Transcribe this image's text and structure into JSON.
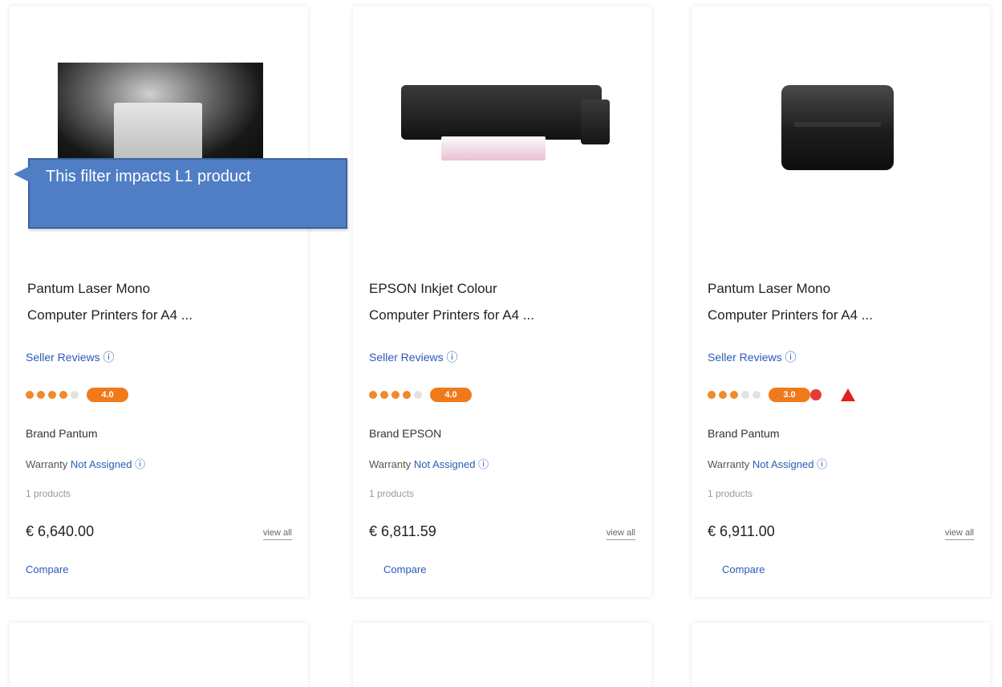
{
  "callout": {
    "text": "This filter impacts L1 product"
  },
  "products": [
    {
      "title_line1": "Pantum Laser Mono",
      "title_line2": "Computer Printers for A4 ...",
      "seller": "Seller Reviews ⓘ",
      "rating_badge": "4.0",
      "brand": "Brand Pantum",
      "warranty_prefix": "Warranty",
      "warranty_link": "Not Assigned ⓘ",
      "filter_text": "1 products",
      "price": "€ 6,640.00",
      "view_label": "view all",
      "compare_label": "Compare"
    },
    {
      "title_line1": "EPSON Inkjet Colour",
      "title_line2": "Computer Printers for A4 ...",
      "seller": "Seller Reviews ⓘ",
      "rating_badge": "4.0",
      "brand": "Brand EPSON",
      "warranty_prefix": "Warranty",
      "warranty_link": "Not Assigned ⓘ",
      "filter_text": "1 products",
      "price": "€ 6,811.59",
      "view_label": "view all",
      "compare_label": "Compare"
    },
    {
      "title_line1": "Pantum Laser Mono",
      "title_line2": "Computer Printers for A4 ...",
      "seller": "Seller Reviews ⓘ",
      "rating_badge": "3.0",
      "brand": "Brand Pantum",
      "warranty_prefix": "Warranty",
      "warranty_link": "Not Assigned ⓘ",
      "filter_text": "1 products",
      "price": "€ 6,911.00",
      "view_label": "view all",
      "compare_label": "Compare"
    }
  ],
  "ratings": [
    4,
    4,
    3
  ]
}
